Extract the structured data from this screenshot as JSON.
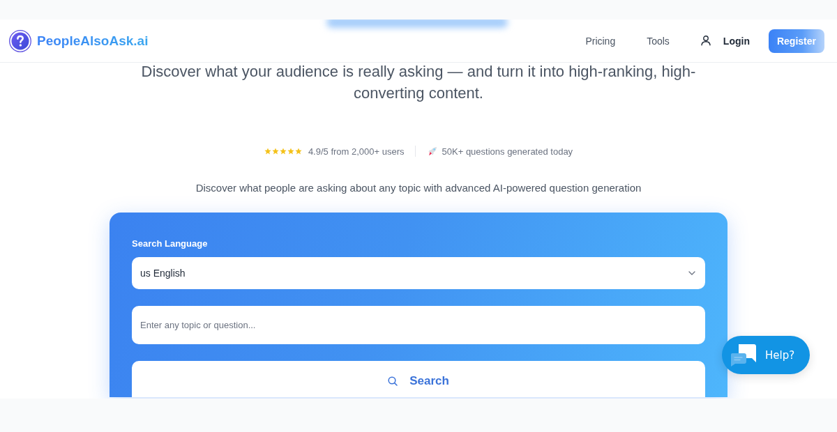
{
  "header": {
    "logo": "PeopleAlsoAsk.ai",
    "nav": [
      {
        "label": "Pricing",
        "kind": "link"
      },
      {
        "label": "Tools",
        "kind": "link"
      },
      {
        "label": "Login",
        "kind": "account"
      }
    ],
    "register": "Register"
  },
  "hero": {
    "tagline": "Discover what your audience is really asking — and turn it into high-ranking, high-converting content.",
    "rating": {
      "stars": 5,
      "text": "4.9/5 from 2,000+ users"
    },
    "generated": "50K+ questions generated today",
    "subtitle": "Discover what people are asking about any topic with advanced AI-powered question generation"
  },
  "search_form": {
    "language_label": "Search Language",
    "language_value": "us English",
    "topic_placeholder": "Enter any topic or question...",
    "button": "Search"
  },
  "help_button": "Help?"
}
